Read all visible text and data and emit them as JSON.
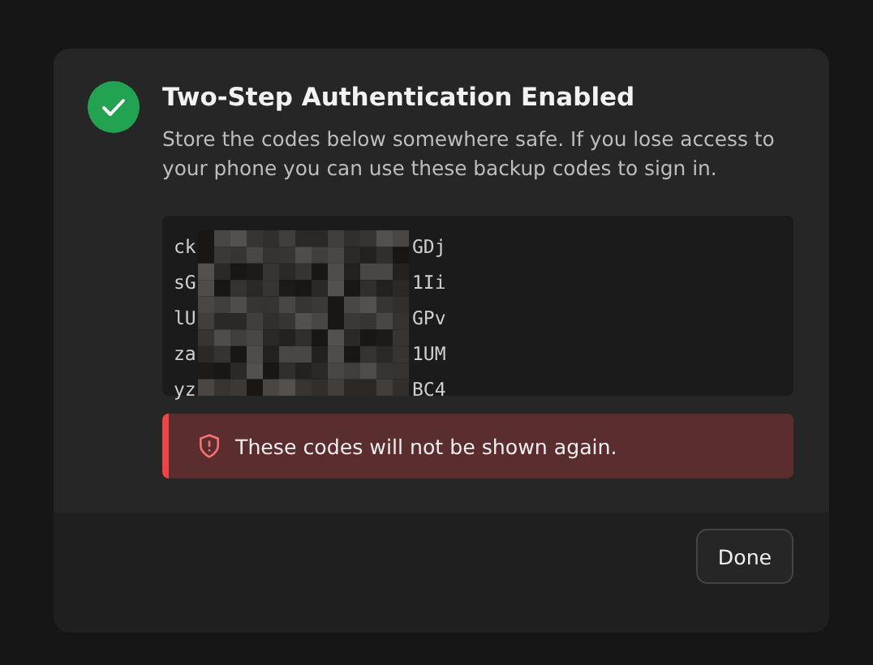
{
  "dialog": {
    "title": "Two-Step Authentication Enabled",
    "description": "Store the codes below somewhere safe. If you lose access to your phone you can use these backup codes to sign in.",
    "codes": [
      {
        "start": "ck",
        "end": "GDj"
      },
      {
        "start": "sG",
        "end": "1Ii"
      },
      {
        "start": "lU",
        "end": "GPv"
      },
      {
        "start": "za",
        "end": "1UM"
      },
      {
        "start": "yz",
        "end": "BC4"
      }
    ],
    "warning": "These codes will not be shown again.",
    "buttons": [
      "Done"
    ]
  }
}
